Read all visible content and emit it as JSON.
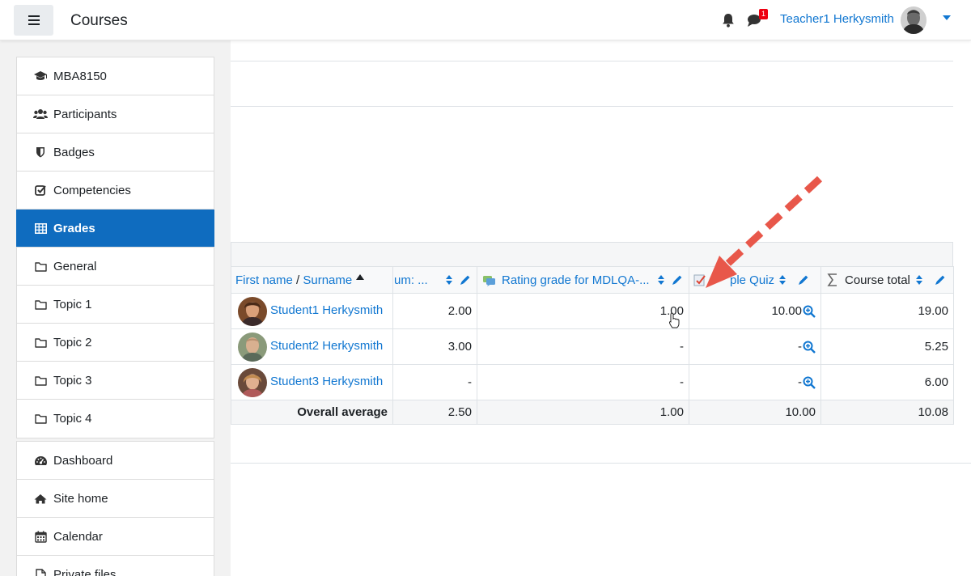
{
  "navbar": {
    "brand": "Courses",
    "notifications_count": "1",
    "user_name": "Teacher1 Herkysmith"
  },
  "drawer": {
    "course_items": [
      {
        "label": "MBA8150",
        "icon": "graduation-cap-icon"
      },
      {
        "label": "Participants",
        "icon": "users-icon"
      },
      {
        "label": "Badges",
        "icon": "shield-icon"
      },
      {
        "label": "Competencies",
        "icon": "check-square-icon"
      },
      {
        "label": "Grades",
        "icon": "table-icon",
        "active": true
      },
      {
        "label": "General",
        "icon": "folder-icon"
      },
      {
        "label": "Topic 1",
        "icon": "folder-icon"
      },
      {
        "label": "Topic 2",
        "icon": "folder-icon"
      },
      {
        "label": "Topic 3",
        "icon": "folder-icon"
      },
      {
        "label": "Topic 4",
        "icon": "folder-icon"
      }
    ],
    "site_items": [
      {
        "label": "Dashboard",
        "icon": "dashboard-icon"
      },
      {
        "label": "Site home",
        "icon": "home-icon"
      },
      {
        "label": "Calendar",
        "icon": "calendar-icon"
      },
      {
        "label": "Private files",
        "icon": "file-icon"
      }
    ]
  },
  "grades": {
    "header": {
      "first_name": "First name",
      "separator": " / ",
      "surname": "Surname",
      "col2": "um: ...",
      "col3": "Rating grade for MDLQA-...",
      "col4": "ple Quiz",
      "col5": "Course total"
    },
    "rows": [
      {
        "name": "Student1 Herkysmith",
        "col2": "2.00",
        "col3": "1.00",
        "col4": "10.00",
        "col5": "19.00"
      },
      {
        "name": "Student2 Herkysmith",
        "col2": "3.00",
        "col3": "-",
        "col4": "-",
        "col5": "5.25"
      },
      {
        "name": "Student3 Herkysmith",
        "col2": "-",
        "col3": "-",
        "col4": "-",
        "col5": "6.00"
      }
    ],
    "average": {
      "label": "Overall average",
      "col2": "2.50",
      "col3": "1.00",
      "col4": "10.00",
      "col5": "10.08"
    }
  },
  "colors": {
    "accent": "#0f6cbf",
    "link": "#1177d1",
    "annotation_arrow": "#e8574a"
  }
}
